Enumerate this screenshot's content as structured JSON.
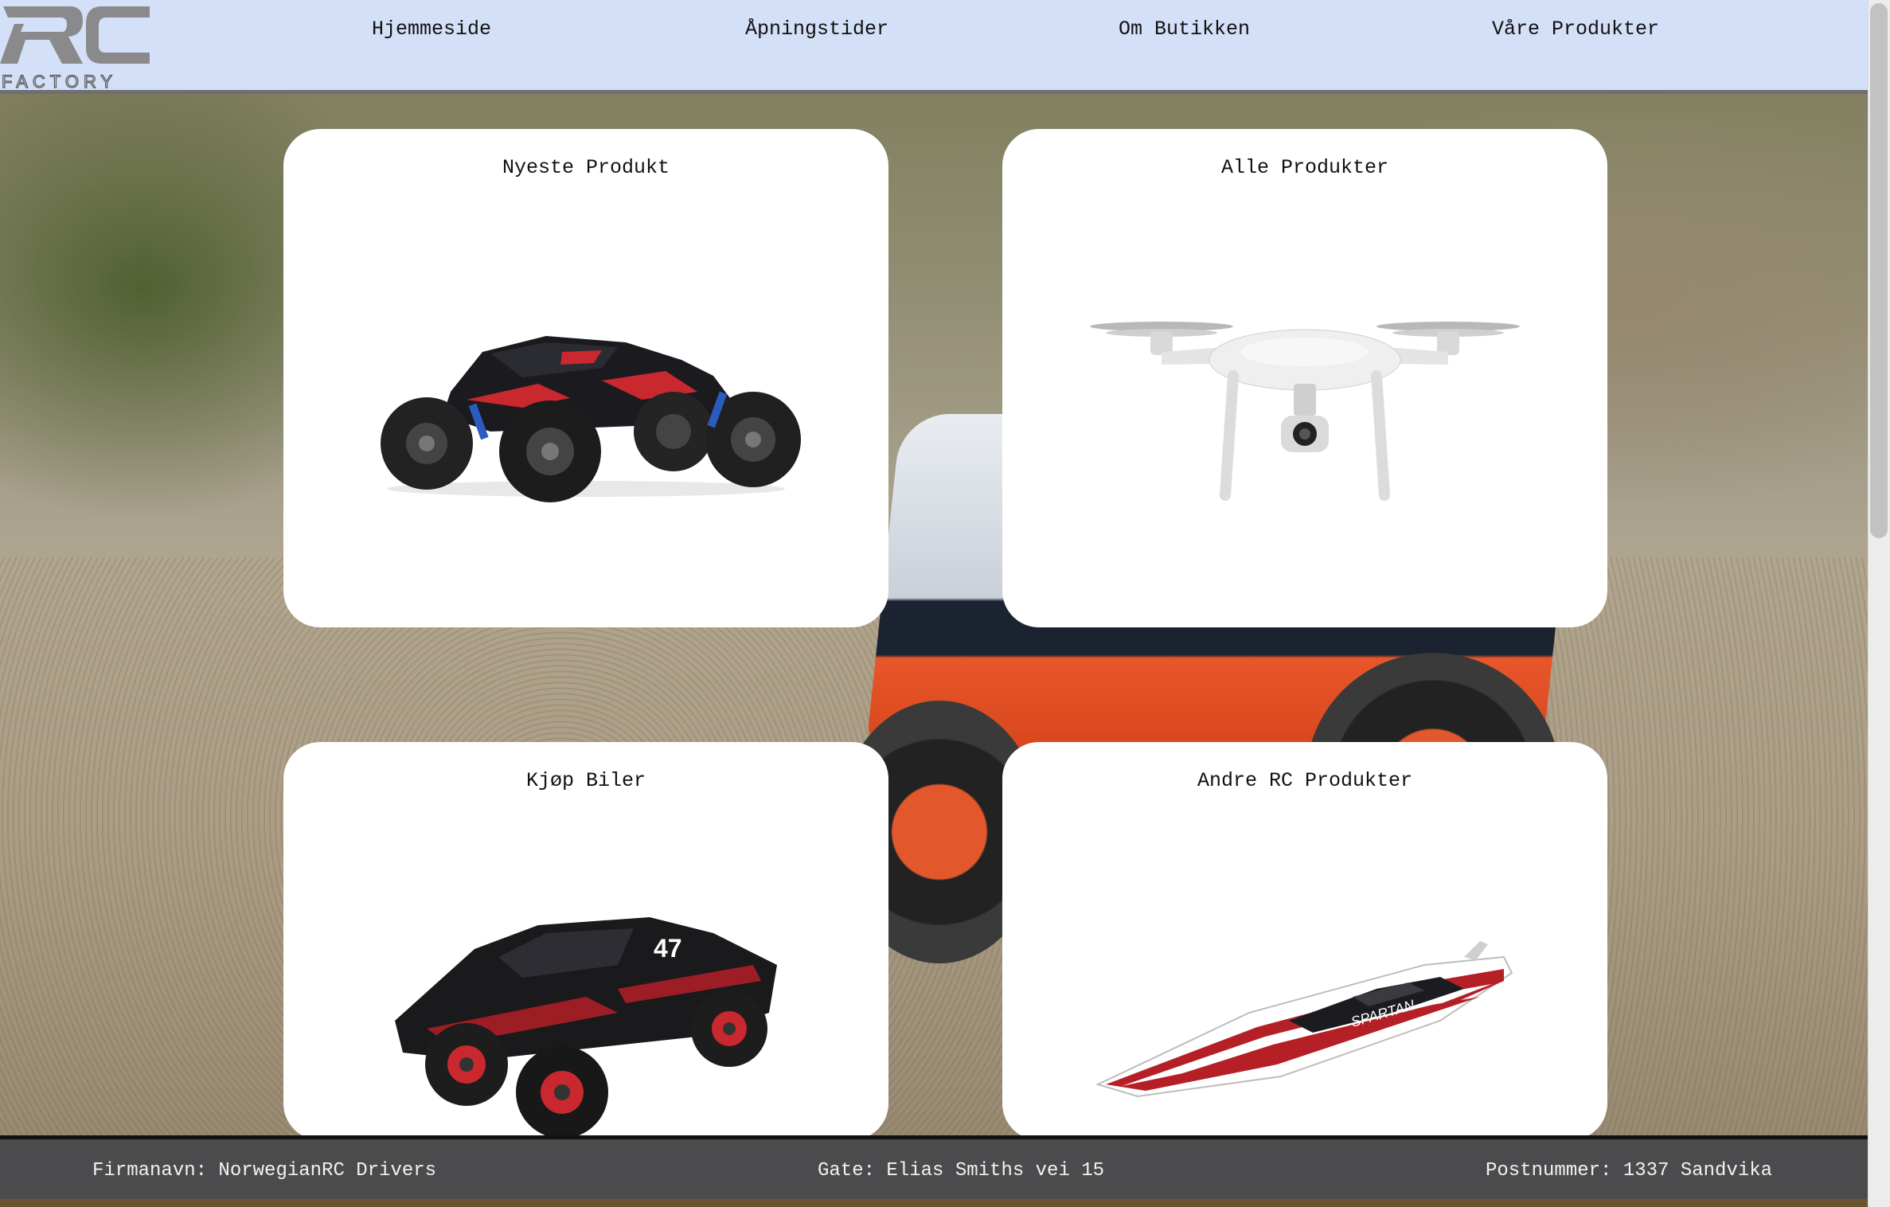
{
  "logo": {
    "letters": "RC",
    "word": "FACTORY"
  },
  "nav": [
    {
      "label": "Hjemmeside"
    },
    {
      "label": "Åpningstider"
    },
    {
      "label": "Om Butikken"
    },
    {
      "label": "Våre Produkter"
    }
  ],
  "cards": [
    {
      "title": "Nyeste Produkt",
      "image": "monster-truck-image"
    },
    {
      "title": "Alle Produkter",
      "image": "drone-image"
    },
    {
      "title": "Kjøp Biler",
      "image": "short-course-truck-image"
    },
    {
      "title": "Andre RC Produkter",
      "image": "speedboat-image"
    }
  ],
  "footer": {
    "company": "Firmanavn: NorwegianRC Drivers",
    "street": "Gate: Elias Smiths vei 15",
    "postal": "Postnummer: 1337 Sandvika"
  },
  "colors": {
    "header_bg": "#d4e0f7",
    "footer_bg": "#4b4b4d",
    "card_bg": "#ffffff",
    "accent_red": "#c8282e"
  }
}
